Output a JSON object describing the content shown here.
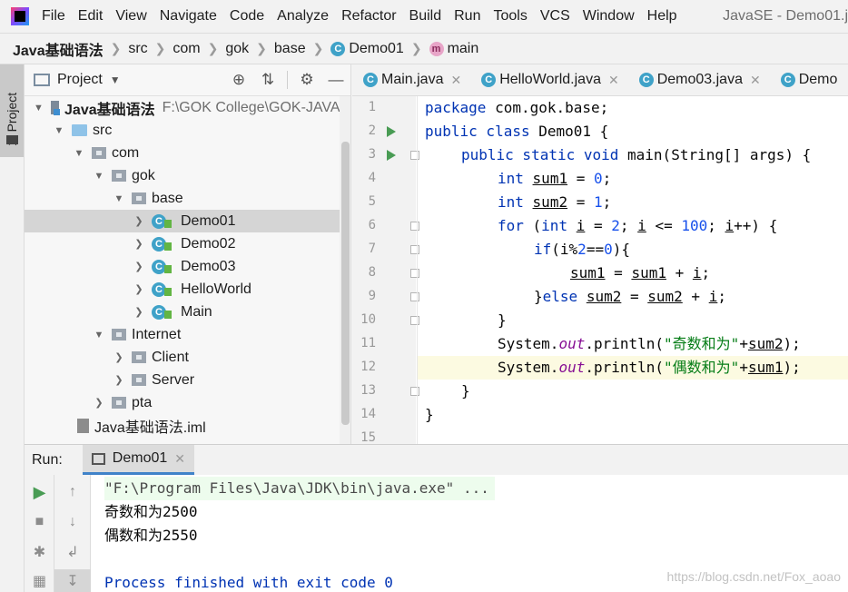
{
  "menubar": {
    "items": [
      "File",
      "Edit",
      "View",
      "Navigate",
      "Code",
      "Analyze",
      "Refactor",
      "Build",
      "Run",
      "Tools",
      "VCS",
      "Window",
      "Help"
    ],
    "title": "JavaSE - Demo01.j"
  },
  "breadcrumb": [
    "Java基础语法",
    "src",
    "com",
    "gok",
    "base",
    "Demo01",
    "main"
  ],
  "project": {
    "title": "Project",
    "root_name": "Java基础语法",
    "root_path": "F:\\GOK College\\GOK-JAVA\\J",
    "src": "src",
    "com": "com",
    "gok": "gok",
    "base": "base",
    "classes": [
      "Demo01",
      "Demo02",
      "Demo03",
      "HelloWorld",
      "Main"
    ],
    "internet": "Internet",
    "internet_children": [
      "Client",
      "Server"
    ],
    "pta": "pta",
    "iml": "Java基础语法.iml",
    "selected": "Demo01"
  },
  "leftstrip": {
    "tab_label": "1: Project"
  },
  "editor": {
    "tabs": [
      "Main.java",
      "HelloWorld.java",
      "Demo03.java",
      "Demo"
    ],
    "line_numbers": [
      "1",
      "2",
      "3",
      "4",
      "5",
      "6",
      "7",
      "8",
      "9",
      "10",
      "11",
      "12",
      "13",
      "14",
      "15"
    ],
    "current_line": "12",
    "code": {
      "l1_kw": "package",
      "l1_rest": " com.gok.base;",
      "l2_kw": "public class",
      "l2_rest": " Demo01 {",
      "l3_kw": "public static void",
      "l3_rest": " main(String[] args) {",
      "l4_kw": "int",
      "l4_var": "sum1",
      "l4_eq": " = ",
      "l4_num": "0",
      "l4_end": ";",
      "l5_kw": "int",
      "l5_var": "sum2",
      "l5_eq": " = ",
      "l5_num": "1",
      "l5_end": ";",
      "l6_kw": "for",
      "l6_a": " (",
      "l6_kw2": "int",
      "l6_i1": "i",
      "l6_b": " = ",
      "l6_n1": "2",
      "l6_c": "; ",
      "l6_i2": "i",
      "l6_d": " <= ",
      "l6_n2": "100",
      "l6_e": "; ",
      "l6_i3": "i",
      "l6_f": "++) {",
      "l7_kw": "if",
      "l7_a": "(i%",
      "l7_n1": "2",
      "l7_b": "==",
      "l7_n2": "0",
      "l7_c": "){",
      "l8_v1": "sum1",
      "l8_a": " = ",
      "l8_v2": "sum1",
      "l8_b": " + ",
      "l8_i": "i",
      "l8_c": ";",
      "l9_a": "}",
      "l9_kw": "else",
      "l9_b": " ",
      "l9_v1": "sum2",
      "l9_c": " = ",
      "l9_v2": "sum2",
      "l9_d": " + ",
      "l9_i": "i",
      "l9_e": ";",
      "l10": "}",
      "l11_a": "System.",
      "l11_fld": "out",
      "l11_b": ".println(",
      "l11_str": "\"奇数和为\"",
      "l11_c": "+",
      "l11_v": "sum2",
      "l11_d": ");",
      "l12_a": "System.",
      "l12_fld": "out",
      "l12_b": ".println(",
      "l12_str": "\"偶数和为\"",
      "l12_c": "+",
      "l12_v": "sum1",
      "l12_d": ");",
      "l13": "}",
      "l14": "}"
    }
  },
  "run": {
    "label": "Run:",
    "tab": "Demo01",
    "console": [
      "\"F:\\Program Files\\Java\\JDK\\bin\\java.exe\" ...",
      "奇数和为2500",
      "偶数和为2550",
      "",
      "Process finished with exit code 0"
    ],
    "watermark": "https://blog.csdn.net/Fox_aoao"
  },
  "colors": {
    "keyword": "#0033b3",
    "number": "#1750eb",
    "string": "#067d17",
    "static_field": "#871094",
    "run_green": "#499c54",
    "class_icon": "#3fa2c8"
  },
  "icons": [
    "search-icon",
    "collapse-icon",
    "gear-icon",
    "minimize-icon",
    "run-icon",
    "stop-icon",
    "up-arrow-icon",
    "down-arrow-icon",
    "soft-wrap-icon",
    "scroll-to-end-icon"
  ]
}
